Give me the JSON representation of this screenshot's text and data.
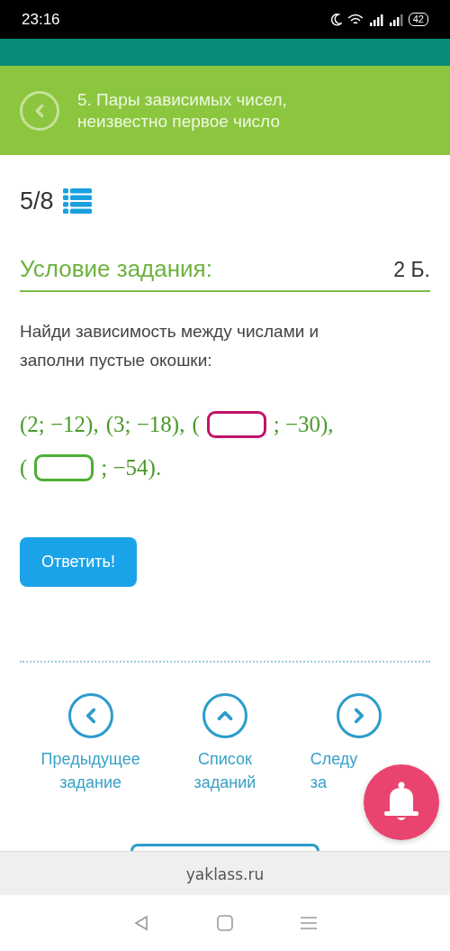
{
  "status_bar": {
    "time": "23:16",
    "battery": "42"
  },
  "header": {
    "title_lines": [
      "5. Пары зависимых чисел,",
      "неизвестно первое число"
    ]
  },
  "progress": {
    "text": "5/8"
  },
  "task": {
    "heading": "Условие задания:",
    "points": "2 Б.",
    "prompt": "Найди зависимость между числами и заполни пустые окошки:",
    "lines": [
      [
        {
          "kind": "text",
          "text": "(2; −12),"
        },
        {
          "kind": "text",
          "text": "(3; −18),"
        },
        {
          "kind": "text",
          "text": "("
        },
        {
          "kind": "blank",
          "selected": true
        },
        {
          "kind": "text",
          "text": "; −30),"
        }
      ],
      [
        {
          "kind": "text",
          "text": "("
        },
        {
          "kind": "blank",
          "selected": false
        },
        {
          "kind": "text",
          "text": "; −54)."
        }
      ]
    ]
  },
  "answer_button": "Ответить!",
  "nav": [
    {
      "kind": "prev",
      "lines": [
        "Предыдущее",
        "задание"
      ]
    },
    {
      "kind": "list",
      "lines": [
        "Список",
        "заданий"
      ]
    },
    {
      "kind": "next",
      "lines": [
        "Следу",
        "за"
      ]
    }
  ],
  "url": "yaklass.ru"
}
